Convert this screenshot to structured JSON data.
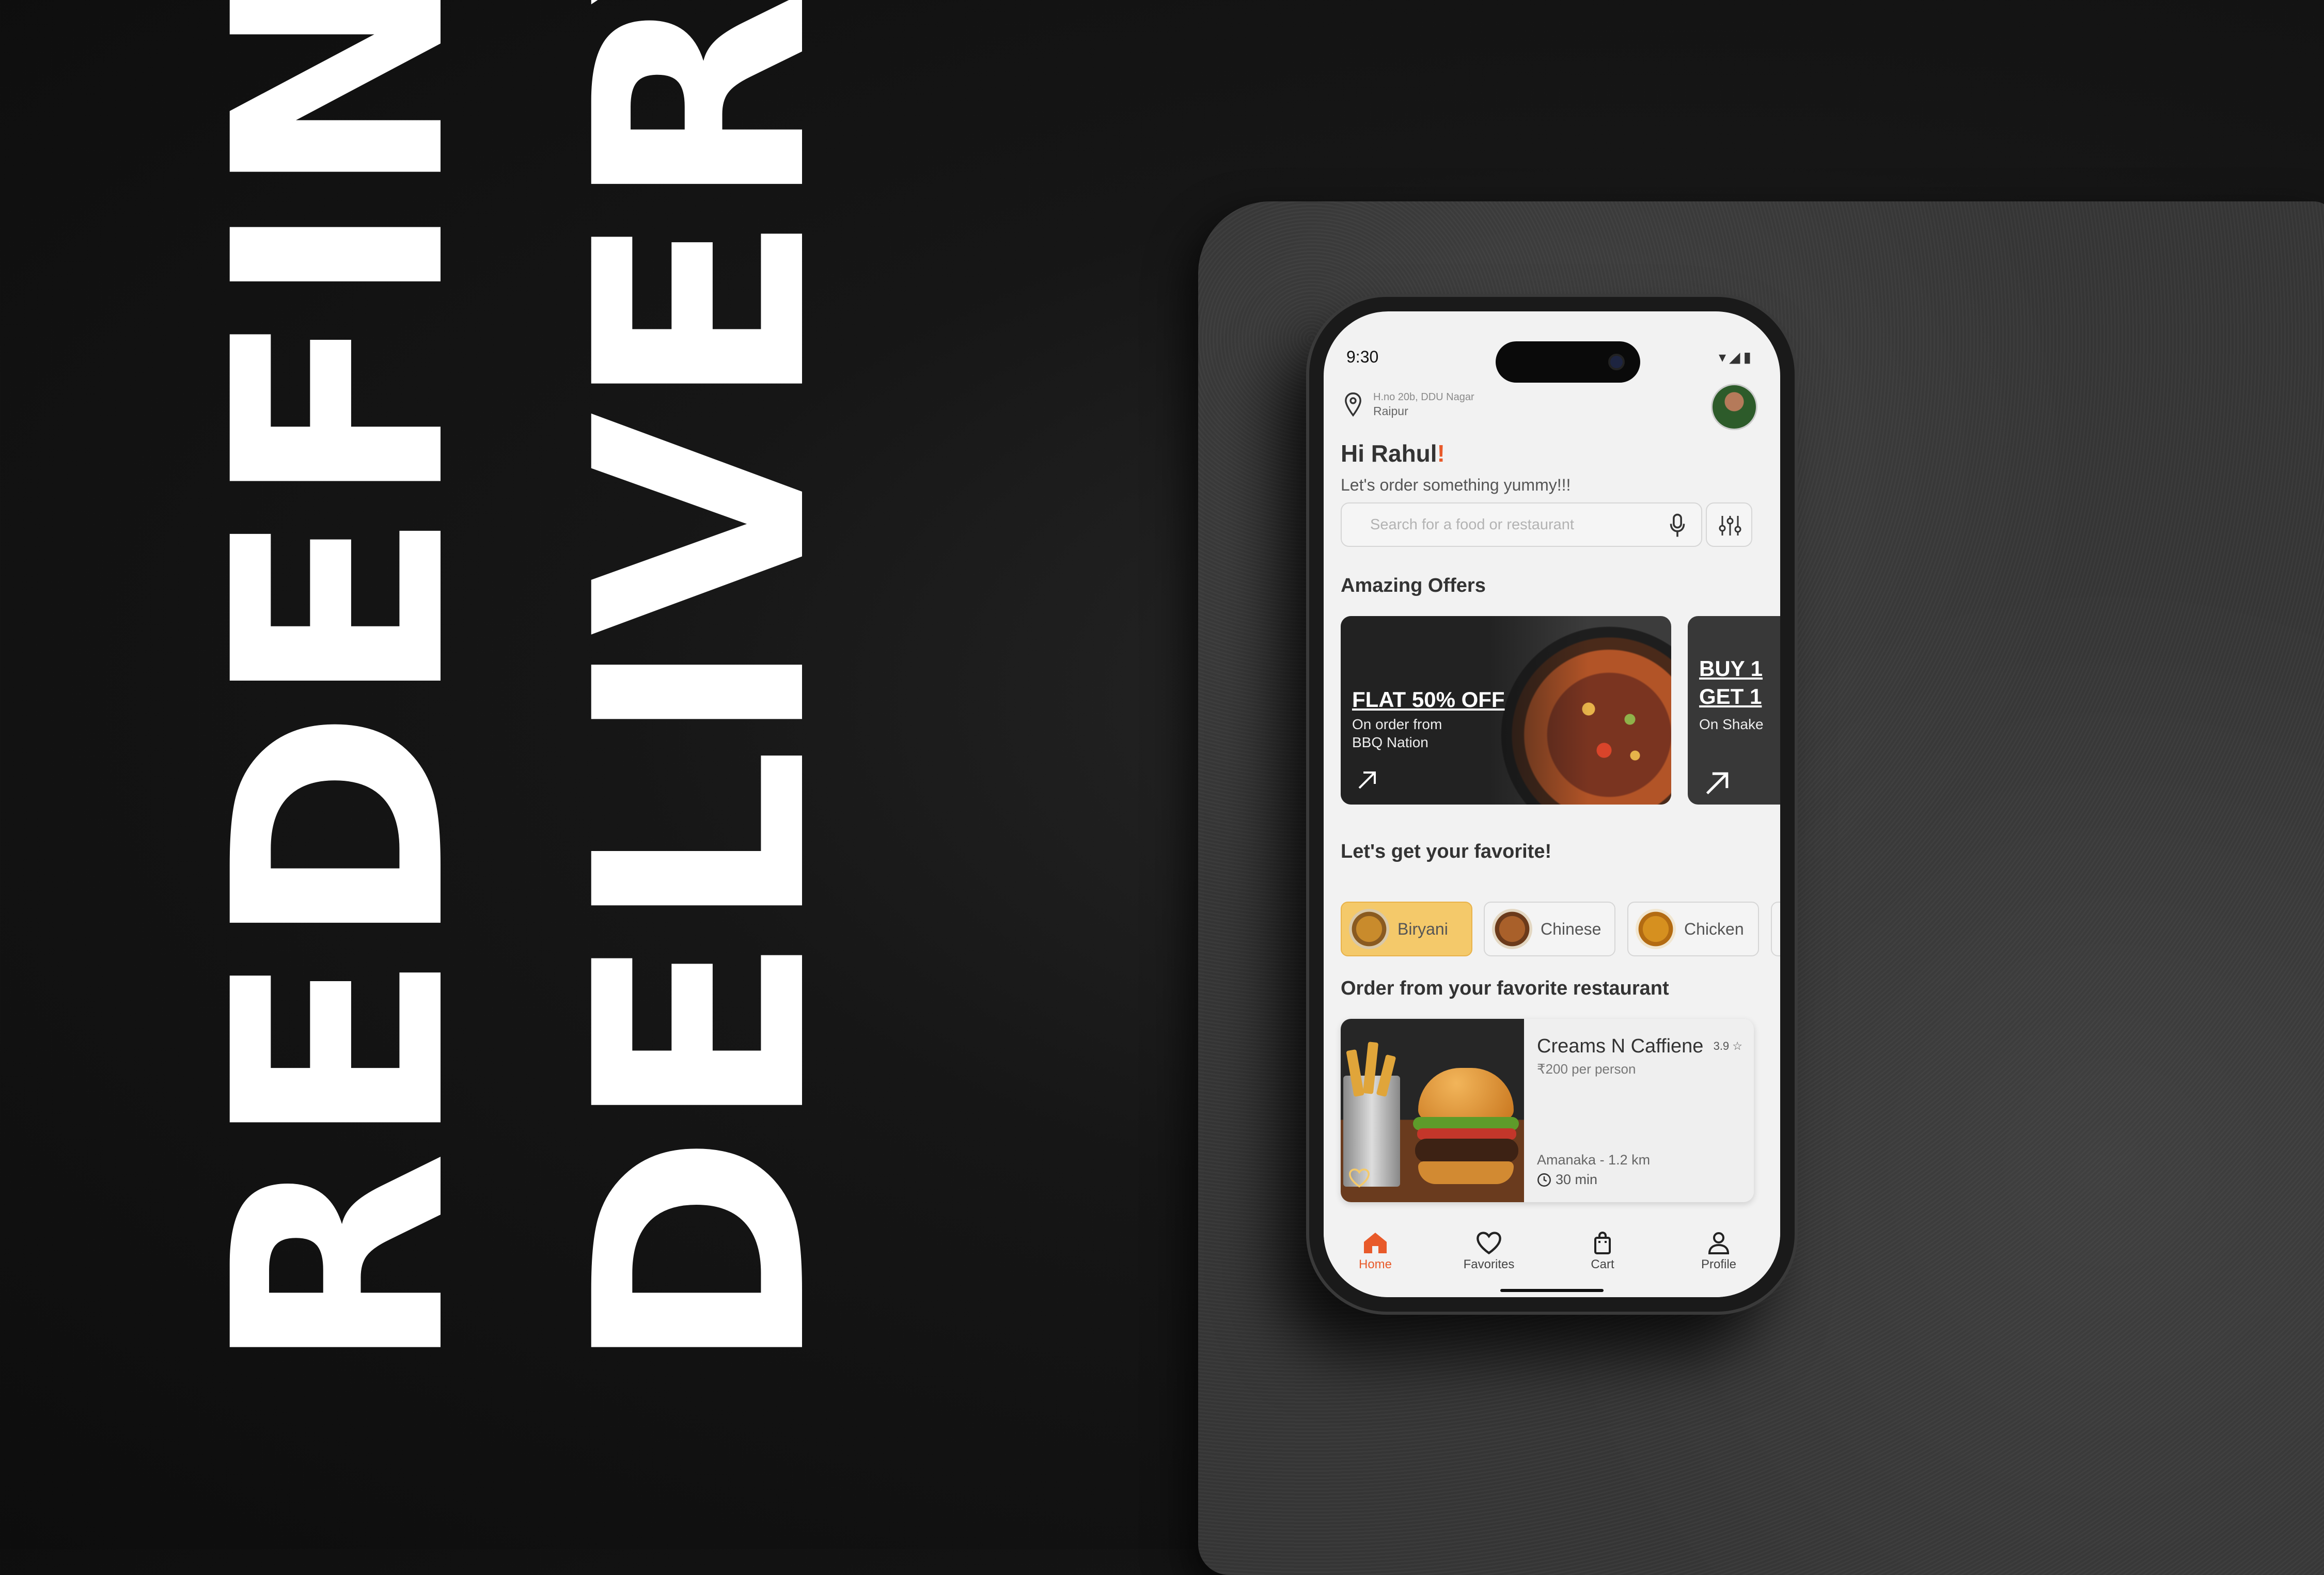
{
  "headline": {
    "line1": "REDEFINING",
    "line2": "DELIVERY"
  },
  "status_bar": {
    "time": "9:30",
    "icons": "▾◢▮"
  },
  "location": {
    "line1": "H.no 20b, DDU Nagar",
    "line2": "Raipur",
    "icon": "location-pin-icon"
  },
  "greeting": {
    "title": "Hi Rahul",
    "accent": "!",
    "subtitle": "Let's order something yummy!!!"
  },
  "search": {
    "placeholder": "Search for a food or restaurant",
    "mic_icon": "mic-icon",
    "filter_icon": "sliders-icon"
  },
  "sections": {
    "offers": "Amazing Offers",
    "favorites": "Let's get your favorite!",
    "restaurants": "Order from your favorite restaurant"
  },
  "offers": [
    {
      "title": "FLAT 50% OFF",
      "subtitle_line1": "On order from",
      "subtitle_line2": "BBQ Nation"
    },
    {
      "title_line1": "BUY 1",
      "title_line2": "GET 1",
      "subtitle": "On Shake"
    }
  ],
  "categories": [
    {
      "label": "Biryani",
      "active": true
    },
    {
      "label": "Chinese",
      "active": false
    },
    {
      "label": "Chicken",
      "active": false
    }
  ],
  "restaurant": {
    "name": "Creams N Caffiene",
    "rating": "3.9 ☆",
    "price": "₹200 per person",
    "location": "Amanaka - 1.2 km",
    "time": "30 min"
  },
  "tabs": [
    {
      "label": "Home",
      "icon": "home-icon",
      "active": true
    },
    {
      "label": "Favorites",
      "icon": "heart-icon",
      "active": false
    },
    {
      "label": "Cart",
      "icon": "bag-icon",
      "active": false
    },
    {
      "label": "Profile",
      "icon": "person-icon",
      "active": false
    }
  ],
  "colors": {
    "accent": "#e85a2a",
    "chip_active": "#f4c96a",
    "background": "#111111",
    "screen": "#f2f2f2"
  }
}
